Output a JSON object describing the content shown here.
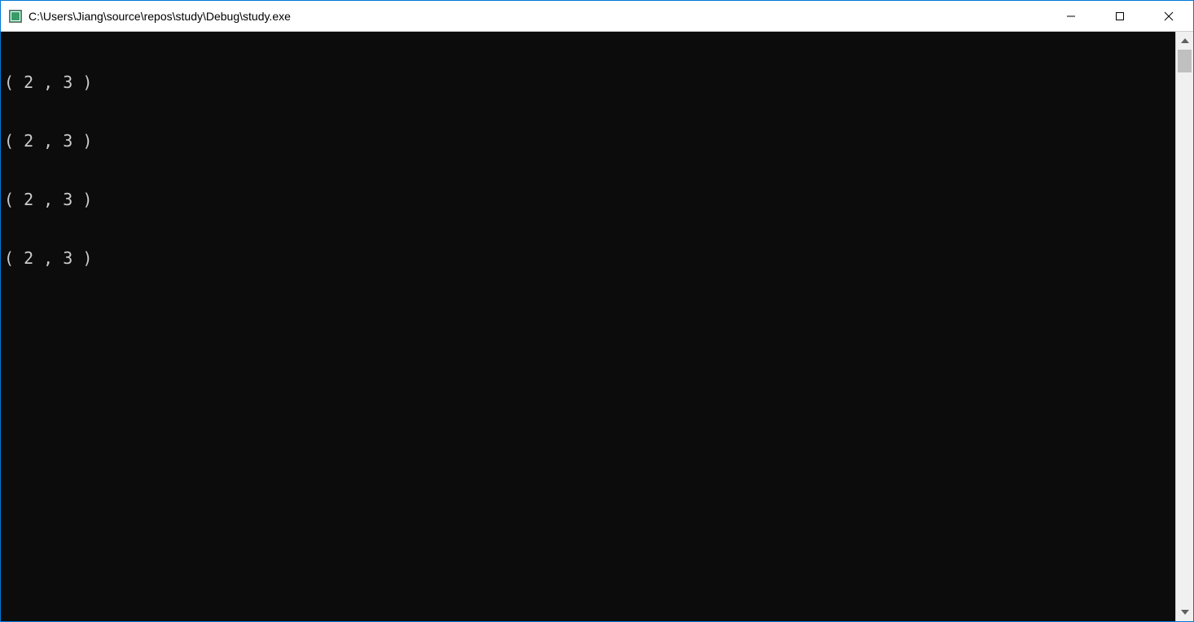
{
  "window": {
    "title": "C:\\Users\\Jiang\\source\\repos\\study\\Debug\\study.exe"
  },
  "console": {
    "lines": [
      "( 2 , 3 )",
      "( 2 , 3 )",
      "( 2 , 3 )",
      "( 2 , 3 )"
    ]
  }
}
